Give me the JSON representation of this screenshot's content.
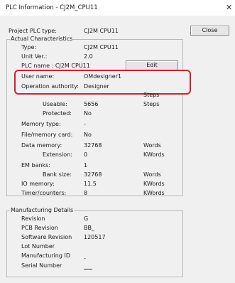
{
  "window": {
    "title": "PLC Information - CJ2M_CPU11",
    "close_icon": "close-icon"
  },
  "header": {
    "project_plc_type_label": "Project PLC type:",
    "project_plc_type_value": "CJ2M CPU11",
    "close_button": "Close"
  },
  "actual": {
    "group_label": "Actual Characteristics",
    "type_label": "Type:",
    "type_value": "CJ2M CPU11",
    "unit_ver_label": "Unit Ver.:",
    "unit_ver_value": "2.0",
    "plc_name_label": "PLC name : CJ2M CPU11",
    "edit_button": "Edit",
    "user_name_label": "User name:",
    "user_name_value": "OMdesigner1",
    "operation_authority_label": "Operation authority:",
    "operation_authority_value": "Designer",
    "program_memory_unit": "Steps",
    "useable_label": "Useable:",
    "useable_value": "5656",
    "useable_unit": "Steps",
    "protected_label": "Protected:",
    "protected_value": "No",
    "memory_type_label": "Memory type:",
    "memory_type_value": "-",
    "file_memory_label": "File/memory card:",
    "file_memory_value": "No",
    "data_memory_label": "Data memory:",
    "data_memory_value": "32768",
    "data_memory_unit": "Words",
    "extension_label": "Extension:",
    "extension_value": "0",
    "extension_unit": "KWords",
    "em_banks_label": "EM banks:",
    "em_banks_value": "1",
    "bank_size_label": "Bank size:",
    "bank_size_value": "32768",
    "bank_size_unit": "Words",
    "io_memory_label": "IO memory:",
    "io_memory_value": "11.5",
    "io_memory_unit": "KWords",
    "timer_counters_label": "Timer/counters:",
    "timer_counters_value": "8",
    "timer_counters_unit": "KWords"
  },
  "manufacturing": {
    "group_label": "Manufacturing Details",
    "revision_label": "Revision",
    "revision_value": "G",
    "pcb_revision_label": "PCB Revision",
    "pcb_revision_value": "BB_",
    "software_revision_label": "Software Revision",
    "software_revision_value": "120517",
    "lot_number_label": "Lot Number",
    "manufacturing_id_label": "Manufacturing ID",
    "manufacturing_id_value": "-",
    "serial_number_label": "Serial Number"
  },
  "colors": {
    "highlight": "#d71f2a",
    "background": "#f0f0f0"
  }
}
